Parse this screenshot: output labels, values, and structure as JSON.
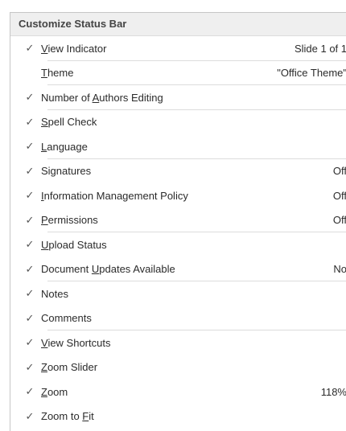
{
  "menu": {
    "title": "Customize Status Bar",
    "items": [
      {
        "pre": "",
        "acc": "V",
        "post": "iew Indicator",
        "checked": true,
        "value": "Slide 1 of 1",
        "separator": true
      },
      {
        "pre": "",
        "acc": "T",
        "post": "heme",
        "checked": false,
        "value": "\"Office Theme\"",
        "separator": true
      },
      {
        "pre": "Number of ",
        "acc": "A",
        "post": "uthors Editing",
        "checked": true,
        "value": "",
        "separator": true
      },
      {
        "pre": "",
        "acc": "S",
        "post": "pell Check",
        "checked": true,
        "value": "",
        "separator": false
      },
      {
        "pre": "",
        "acc": "L",
        "post": "anguage",
        "checked": true,
        "value": "",
        "separator": true
      },
      {
        "pre": "Signatures",
        "acc": "",
        "post": "",
        "checked": true,
        "value": "Off",
        "separator": false
      },
      {
        "pre": "",
        "acc": "I",
        "post": "nformation Management Policy",
        "checked": true,
        "value": "Off",
        "separator": false
      },
      {
        "pre": "",
        "acc": "P",
        "post": "ermissions",
        "checked": true,
        "value": "Off",
        "separator": true
      },
      {
        "pre": "",
        "acc": "U",
        "post": "pload Status",
        "checked": true,
        "value": "",
        "separator": false
      },
      {
        "pre": "Document ",
        "acc": "U",
        "post": "pdates Available",
        "checked": true,
        "value": "No",
        "separator": true
      },
      {
        "pre": "Notes",
        "acc": "",
        "post": "",
        "checked": true,
        "value": "",
        "separator": false
      },
      {
        "pre": "Comments",
        "acc": "",
        "post": "",
        "checked": true,
        "value": "",
        "separator": true
      },
      {
        "pre": "",
        "acc": "V",
        "post": "iew Shortcuts",
        "checked": true,
        "value": "",
        "separator": false
      },
      {
        "pre": "",
        "acc": "Z",
        "post": "oom Slider",
        "checked": true,
        "value": "",
        "separator": false
      },
      {
        "pre": "",
        "acc": "Z",
        "post": "oom",
        "checked": true,
        "value": "118%",
        "separator": false
      },
      {
        "pre": "Zoom to ",
        "acc": "F",
        "post": "it",
        "checked": true,
        "value": "",
        "separator": false
      }
    ]
  }
}
